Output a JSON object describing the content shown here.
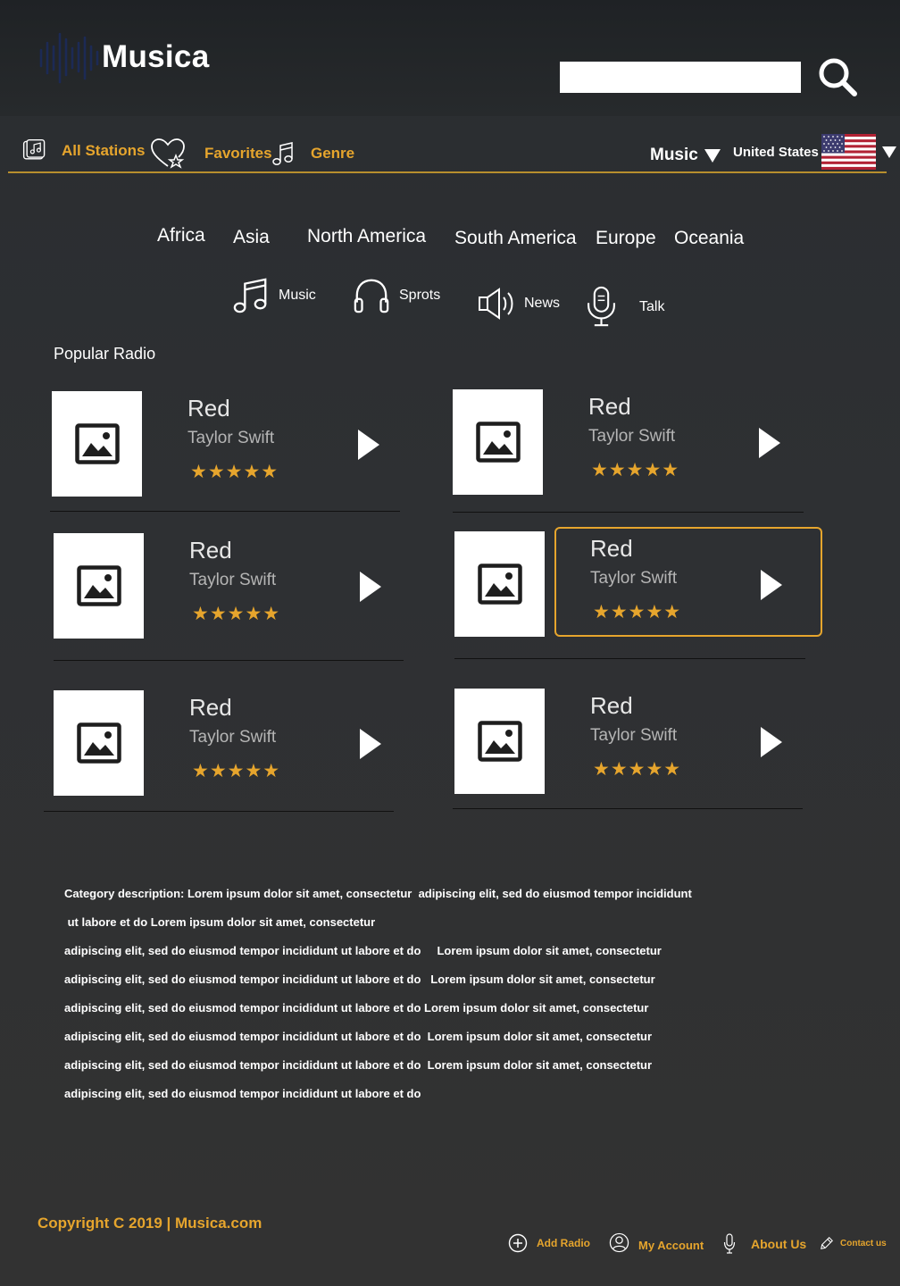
{
  "header": {
    "logo_text": "Musica",
    "search_placeholder": "",
    "search_icon": "search-icon"
  },
  "nav": {
    "all_stations": "All Stations",
    "favorites": "Favorites",
    "genre": "Genre",
    "music_dropdown": "Music",
    "country_dropdown": "United States",
    "accent_color": "#e6a52d"
  },
  "regions": [
    "Africa",
    "Asia",
    "North America",
    "South America",
    "Europe",
    "Oceania"
  ],
  "categories": {
    "music": "Music",
    "sports": "Sprots",
    "news": "News",
    "talk": "Talk"
  },
  "popular": {
    "title": "Popular Radio",
    "cards": [
      {
        "title": "Red",
        "artist": "Taylor Swift",
        "stars": "★★★★★",
        "rating": 5
      },
      {
        "title": "Red",
        "artist": "Taylor Swift",
        "stars": "★★★★★",
        "rating": 5
      },
      {
        "title": "Red",
        "artist": "Taylor Swift",
        "stars": "★★★★★",
        "rating": 5
      },
      {
        "title": "Red",
        "artist": "Taylor Swift",
        "stars": "★★★★★",
        "rating": 5
      },
      {
        "title": "Red",
        "artist": "Taylor Swift",
        "stars": "★★★★★",
        "rating": 5
      },
      {
        "title": "Red",
        "artist": "Taylor Swift",
        "stars": "★★★★★",
        "rating": 5
      }
    ]
  },
  "description": {
    "lines": [
      "Category description: Lorem ipsum dolor sit amet, consectetur  adipiscing elit, sed do eiusmod tempor incididunt",
      " ut labore et do Lorem ipsum dolor sit amet, consectetur",
      "adipiscing elit, sed do eiusmod tempor incididunt ut labore et do     Lorem ipsum dolor sit amet, consectetur",
      "adipiscing elit, sed do eiusmod tempor incididunt ut labore et do   Lorem ipsum dolor sit amet, consectetur",
      "adipiscing elit, sed do eiusmod tempor incididunt ut labore et do Lorem ipsum dolor sit amet, consectetur",
      "adipiscing elit, sed do eiusmod tempor incididunt ut labore et do  Lorem ipsum dolor sit amet, consectetur",
      "adipiscing elit, sed do eiusmod tempor incididunt ut labore et do  Lorem ipsum dolor sit amet, consectetur",
      "adipiscing elit, sed do eiusmod tempor incididunt ut labore et do"
    ]
  },
  "footer": {
    "copyright": "Copyright C 2019 | Musica.com",
    "add_radio": "Add Radio",
    "my_account": "My Account",
    "about_us": "About Us",
    "contact_us": "Contact us"
  }
}
